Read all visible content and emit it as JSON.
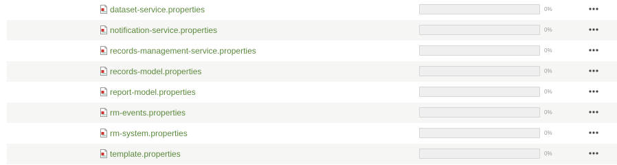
{
  "colors": {
    "link_green": "#5c8a3e",
    "progress_fill": "#78b04a",
    "row_alt_bg": "#f6f6f4",
    "label_gray": "#999999"
  },
  "icons": {
    "file": "document-icon",
    "actions": "more-actions-icon"
  },
  "files": [
    {
      "name": "dataset-service.properties",
      "progress_percent": 0,
      "progress_label": "0%"
    },
    {
      "name": "notification-service.properties",
      "progress_percent": 0,
      "progress_label": "0%"
    },
    {
      "name": "records-management-service.properties",
      "progress_percent": 0,
      "progress_label": "0%"
    },
    {
      "name": "records-model.properties",
      "progress_percent": 0,
      "progress_label": "0%"
    },
    {
      "name": "report-model.properties",
      "progress_percent": 0,
      "progress_label": "0%"
    },
    {
      "name": "rm-events.properties",
      "progress_percent": 0,
      "progress_label": "0%"
    },
    {
      "name": "rm-system.properties",
      "progress_percent": 0,
      "progress_label": "0%"
    },
    {
      "name": "template.properties",
      "progress_percent": 0,
      "progress_label": "0%"
    }
  ]
}
